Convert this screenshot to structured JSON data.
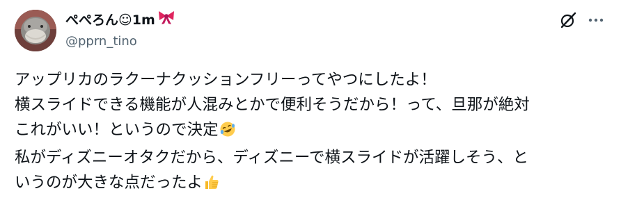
{
  "post": {
    "author": {
      "display_name": "ぺぺろん☺1m",
      "name_emoji": "ribbon-icon",
      "handle": "@pprn_tino",
      "avatar": "avatar"
    },
    "actions": {
      "grok_icon": "grok-icon",
      "more_icon": "more-icon"
    },
    "text_lines": [
      "アップリカのラクーナクッションフリーってやつにしたよ！",
      "横スライドできる機能が人混みとかで便利そうだから！って、旦那が絶対",
      "これがいい！というので決定",
      "私がディズニーオタクだから、ディズニーで横スライドが活躍しそう、と",
      "いうのが大きな点だったよ"
    ],
    "emojis": {
      "line3_end": "rofl-emoji",
      "line5_end": "thumbs-up-emoji"
    }
  },
  "colors": {
    "text": "#0f1419",
    "secondary_text": "#536471",
    "background": "#ffffff"
  }
}
